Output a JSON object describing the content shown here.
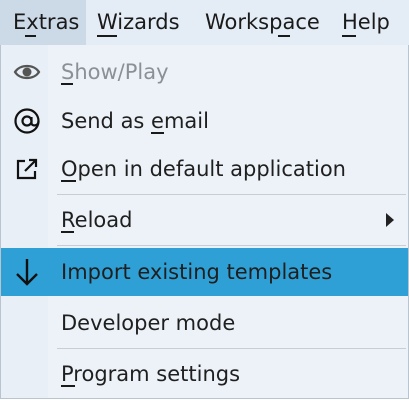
{
  "menubar": {
    "items": [
      {
        "label": "Extras",
        "mnemonic": "x"
      },
      {
        "label": "Wizards",
        "mnemonic": "W"
      },
      {
        "label": "Workspace",
        "mnemonic": "p"
      },
      {
        "label": "Help",
        "mnemonic": "H"
      }
    ]
  },
  "extras_menu": {
    "items": [
      {
        "label": "Show/Play",
        "icon": "eye-icon",
        "state": "disabled",
        "mnemonic": "S"
      },
      {
        "label": "Send as email",
        "icon": "at-sign-icon",
        "mnemonic": "e"
      },
      {
        "label": "Open in default application",
        "icon": "open-external-icon",
        "mnemonic": "O"
      },
      {
        "label": "Reload",
        "mnemonic": "R",
        "has_submenu": true
      },
      {
        "label": "Import existing templates",
        "icon": "arrow-down-icon",
        "state": "highlighted"
      },
      {
        "label": "Developer mode"
      },
      {
        "label": "Program settings",
        "mnemonic": "P"
      }
    ]
  },
  "colors": {
    "menubar_bg": "#e4ecf5",
    "menu_bg": "#ecf2f8",
    "highlight": "#2fa0d6",
    "disabled_text": "#8a9096"
  }
}
